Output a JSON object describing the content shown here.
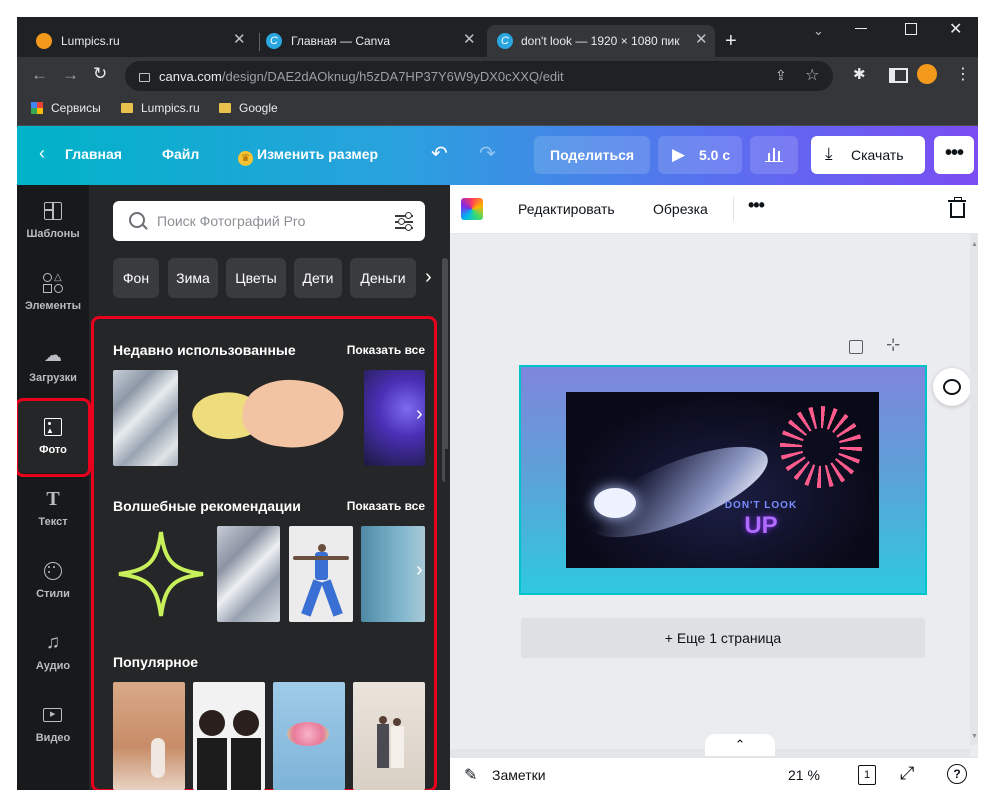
{
  "browser": {
    "tabs": [
      {
        "title": "Lumpics.ru",
        "favicon": "lumpics-orange-icon"
      },
      {
        "title": "Главная — Canva",
        "favicon": "canva-icon"
      },
      {
        "title": "don't look — 1920 × 1080 пик",
        "favicon": "canva-icon"
      }
    ],
    "url_host": "canva.com",
    "url_path": "/design/DAE2dAOknug/h5zDA7HP37Y6W9yDX0cXXQ/edit",
    "bookmarks": [
      "Сервисы",
      "Lumpics.ru",
      "Google"
    ]
  },
  "canva_header": {
    "home": "Главная",
    "file": "Файл",
    "resize": "Изменить размер",
    "share": "Поделиться",
    "play_duration": "5.0 с",
    "download": "Скачать"
  },
  "left_nav": [
    {
      "label": "Шаблоны",
      "icon": "templates-icon"
    },
    {
      "label": "Элементы",
      "icon": "elements-icon"
    },
    {
      "label": "Загрузки",
      "icon": "upload-cloud-icon"
    },
    {
      "label": "Фото",
      "icon": "photo-icon",
      "selected": true
    },
    {
      "label": "Текст",
      "icon": "text-icon"
    },
    {
      "label": "Стили",
      "icon": "palette-icon"
    },
    {
      "label": "Аудио",
      "icon": "music-note-icon"
    },
    {
      "label": "Видео",
      "icon": "video-icon"
    }
  ],
  "panel": {
    "search_placeholder": "Поиск Фотографий Pro",
    "chips": [
      "Фон",
      "Зима",
      "Цветы",
      "Дети",
      "Деньги"
    ],
    "recent_title": "Недавно использованные",
    "magic_title": "Волшебные рекомендации",
    "popular_title": "Популярное",
    "show_all": "Показать все"
  },
  "editor": {
    "edit_label": "Редактировать",
    "crop_label": "Обрезка",
    "design_line1": "DON'T LOOK",
    "design_line2": "UP",
    "add_page": "+ Еще 1 страница",
    "notes": "Заметки",
    "zoom": "21 %",
    "page_count": "1"
  },
  "colors": {
    "highlight": "#e8001c",
    "accent_cyan": "#00c4cc",
    "accent_purple": "#7d2ae8"
  }
}
